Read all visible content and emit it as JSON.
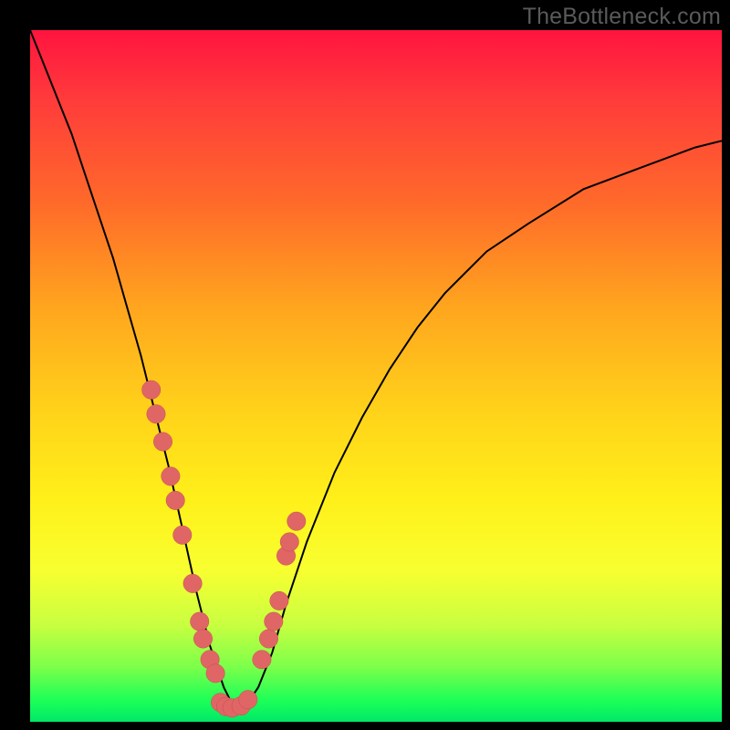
{
  "watermark": "TheBottleneck.com",
  "chart_data": {
    "type": "line",
    "title": "",
    "xlabel": "",
    "ylabel": "",
    "xlim": [
      0,
      100
    ],
    "ylim": [
      0,
      100
    ],
    "curve": {
      "x": [
        0,
        2,
        4,
        6,
        8,
        10,
        12,
        14,
        16,
        18,
        20,
        22,
        24,
        26,
        27,
        28,
        29,
        30,
        31,
        33,
        35,
        37,
        40,
        44,
        48,
        52,
        56,
        60,
        66,
        72,
        80,
        88,
        96,
        100
      ],
      "y": [
        100,
        95,
        90,
        85,
        79,
        73,
        67,
        60,
        53,
        45,
        37,
        28,
        19,
        11,
        8,
        5,
        3,
        2,
        2,
        5,
        10,
        17,
        26,
        36,
        44,
        51,
        57,
        62,
        68,
        72,
        77,
        80,
        83,
        84
      ]
    },
    "points_left": {
      "x": [
        17.5,
        18.2,
        19.2,
        20.3,
        21.0,
        22.0,
        23.5,
        24.5,
        25.0,
        26.0,
        26.8
      ],
      "y": [
        48.0,
        44.5,
        40.5,
        35.5,
        32.0,
        27.0,
        20.0,
        14.5,
        12.0,
        9.0,
        7.0
      ]
    },
    "points_bottom": {
      "x": [
        27.5,
        28.3,
        29.2,
        30.5,
        31.5
      ],
      "y": [
        2.8,
        2.2,
        2.0,
        2.3,
        3.2
      ]
    },
    "points_right": {
      "x": [
        33.5,
        34.5,
        35.2,
        36.0,
        37.0,
        37.5,
        38.5
      ],
      "y": [
        9.0,
        12.0,
        14.5,
        17.5,
        24.0,
        26.0,
        29.0
      ]
    },
    "dot_radius_pct": 1.35
  }
}
